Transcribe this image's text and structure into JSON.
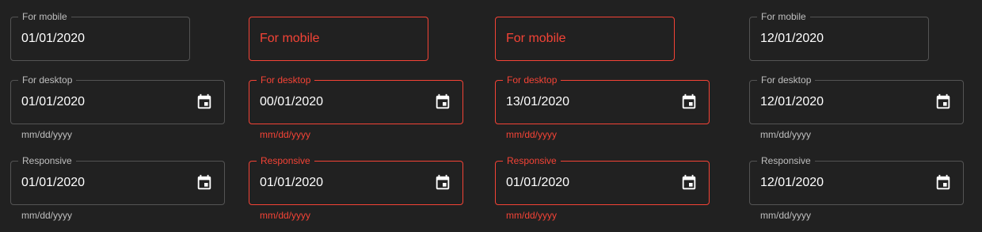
{
  "colors": {
    "background": "#212121",
    "error": "#f44336",
    "text": "#ffffff",
    "muted": "#b3b3b3"
  },
  "icons": {
    "calendar": "calendar-icon"
  },
  "columns": [
    {
      "mobile": {
        "label": "For mobile",
        "value": "01/01/2020",
        "state": "normal"
      },
      "desktop": {
        "label": "For desktop",
        "value": "01/01/2020",
        "helper": "mm/dd/yyyy",
        "state": "normal"
      },
      "responsive": {
        "label": "Responsive",
        "value": "01/01/2020",
        "helper": "mm/dd/yyyy",
        "state": "normal"
      }
    },
    {
      "mobile": {
        "placeholder": "For mobile",
        "state": "error"
      },
      "desktop": {
        "label": "For desktop",
        "value": "00/01/2020",
        "helper": "mm/dd/yyyy",
        "state": "error"
      },
      "responsive": {
        "label": "Responsive",
        "value": "01/01/2020",
        "helper": "mm/dd/yyyy",
        "state": "error"
      }
    },
    {
      "mobile": {
        "placeholder": "For mobile",
        "state": "error"
      },
      "desktop": {
        "label": "For desktop",
        "value": "13/01/2020",
        "helper": "mm/dd/yyyy",
        "state": "error"
      },
      "responsive": {
        "label": "Responsive",
        "value": "01/01/2020",
        "helper": "mm/dd/yyyy",
        "state": "error"
      }
    },
    {
      "mobile": {
        "label": "For mobile",
        "value": "12/01/2020",
        "state": "normal"
      },
      "desktop": {
        "label": "For desktop",
        "value": "12/01/2020",
        "helper": "mm/dd/yyyy",
        "state": "normal"
      },
      "responsive": {
        "label": "Responsive",
        "value": "12/01/2020",
        "helper": "mm/dd/yyyy",
        "state": "normal"
      }
    }
  ]
}
